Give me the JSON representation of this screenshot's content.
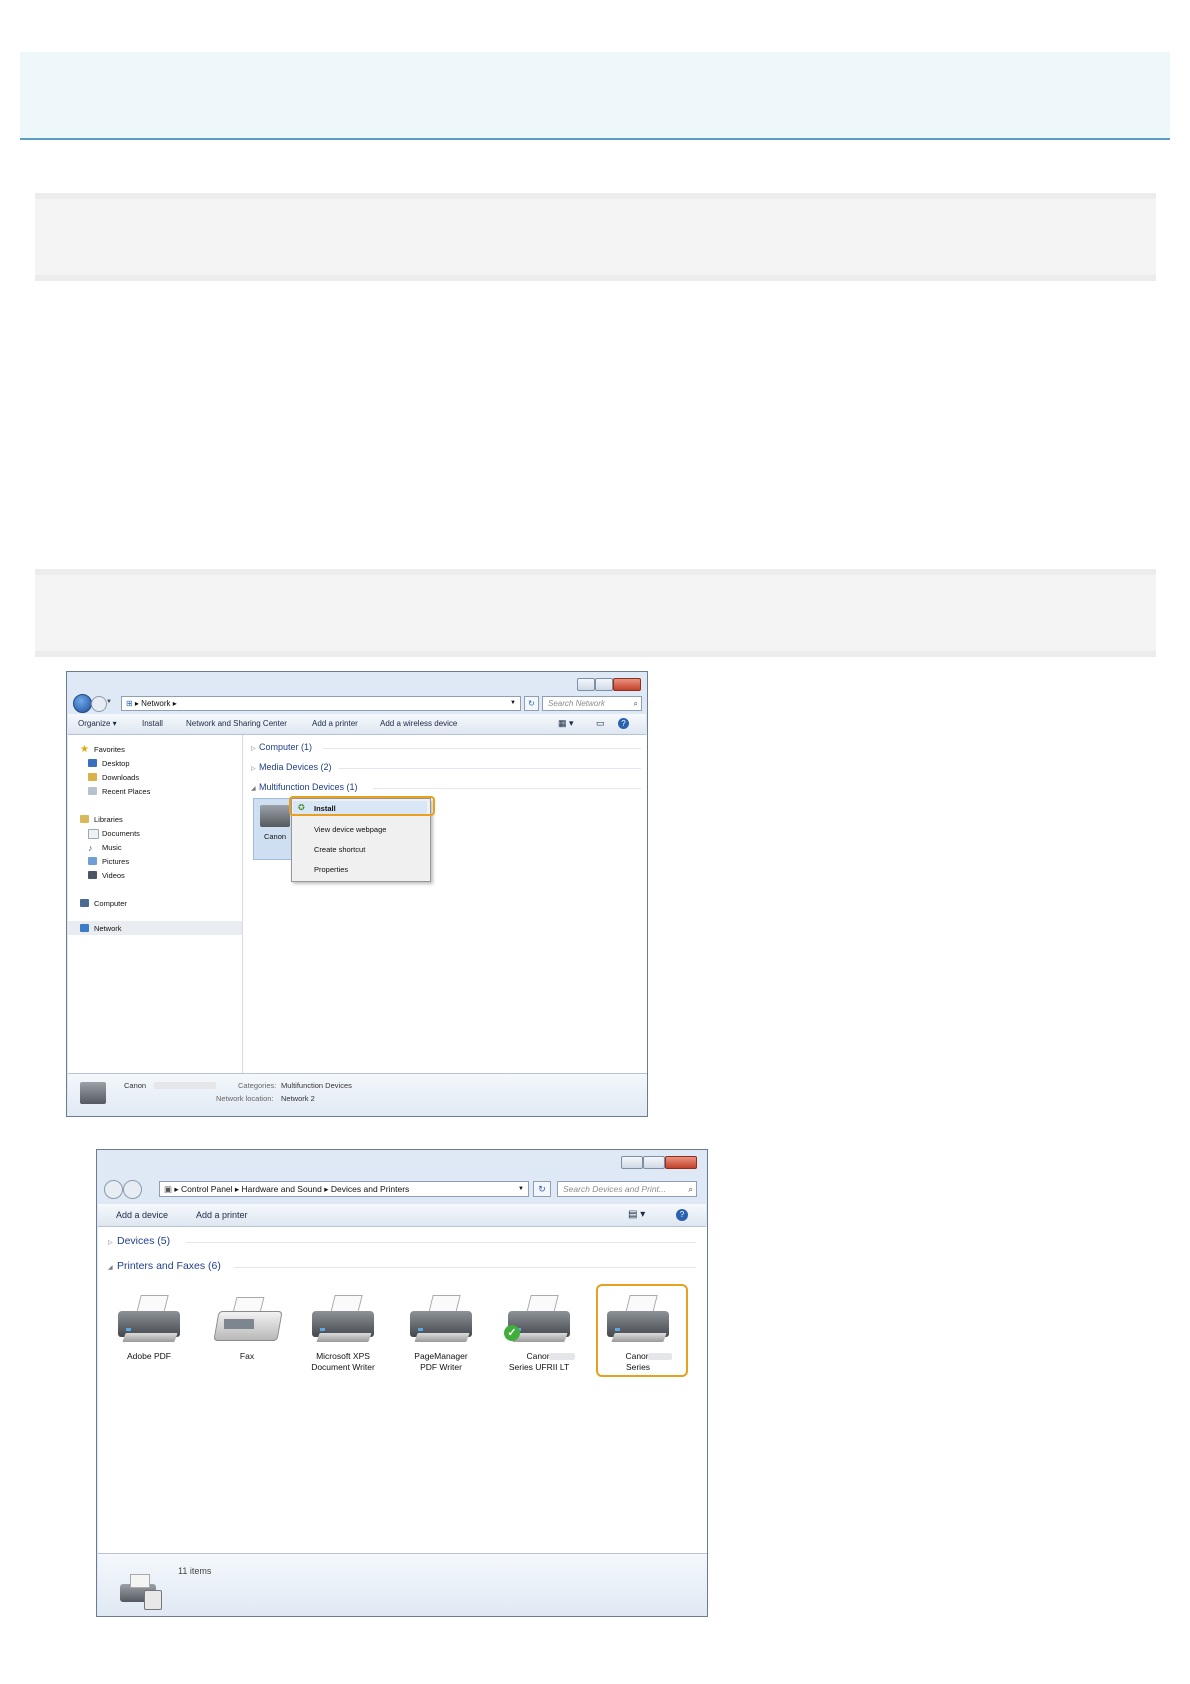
{
  "window_network": {
    "address_path": [
      "Network"
    ],
    "search_placeholder": "Search Network",
    "toolbar": [
      "Organize ▾",
      "Install",
      "Network and Sharing Center",
      "Add a printer",
      "Add a wireless device"
    ],
    "nav": {
      "favorites": "Favorites",
      "desktop": "Desktop",
      "downloads": "Downloads",
      "recent": "Recent Places",
      "libraries": "Libraries",
      "documents": "Documents",
      "music": "Music",
      "pictures": "Pictures",
      "videos": "Videos",
      "computer": "Computer",
      "network": "Network"
    },
    "groups": {
      "computer": "Computer (1)",
      "media": "Media Devices (2)",
      "multifunction": "Multifunction Devices (1)"
    },
    "device_label": "Canon",
    "context_menu": [
      "Install",
      "View device webpage",
      "Create shortcut",
      "Properties"
    ],
    "details": {
      "name": "Canon",
      "categories_label": "Categories:",
      "categories_value": "Multifunction Devices",
      "location_label": "Network location:",
      "location_value": "Network 2"
    }
  },
  "window_devices": {
    "address_path": [
      "Control Panel",
      "Hardware and Sound",
      "Devices and Printers"
    ],
    "search_placeholder": "Search Devices and Print...",
    "toolbar": [
      "Add a device",
      "Add a printer"
    ],
    "groups": {
      "devices": "Devices (5)",
      "printers": "Printers and Faxes (6)"
    },
    "printers": [
      {
        "line1": "Adobe PDF",
        "line2": ""
      },
      {
        "line1": "Fax",
        "line2": ""
      },
      {
        "line1": "Microsoft XPS",
        "line2": "Document Writer"
      },
      {
        "line1": "PageManager",
        "line2": "PDF Writer"
      },
      {
        "line1": "Canon",
        "line2": "Series UFRII LT"
      },
      {
        "line1": "Canon",
        "line2": "Series"
      }
    ],
    "status": "11 items"
  },
  "colors": {
    "highlight": "#e8a020",
    "link_blue": "#1e3f8a",
    "banner_line": "#5a9ec6"
  }
}
